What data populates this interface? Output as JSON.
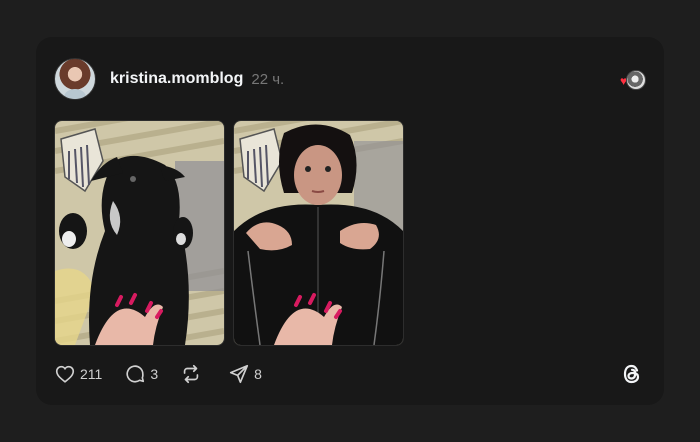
{
  "post": {
    "username": "kristina.momblog",
    "time": "22 ч.",
    "likes": "211",
    "replies": "3",
    "reposts": "",
    "shares": "8"
  },
  "icons": {
    "like": "heart-outline-icon",
    "reply": "speech-bubble-icon",
    "repost": "repost-arrows-icon",
    "share": "paper-plane-icon",
    "brand": "threads-logo-icon"
  },
  "colors": {
    "page_bg": "#1e1e1e",
    "card_bg": "#181818",
    "text_primary": "#f3f5f7",
    "text_muted": "#777777",
    "heart": "#ff3040"
  }
}
